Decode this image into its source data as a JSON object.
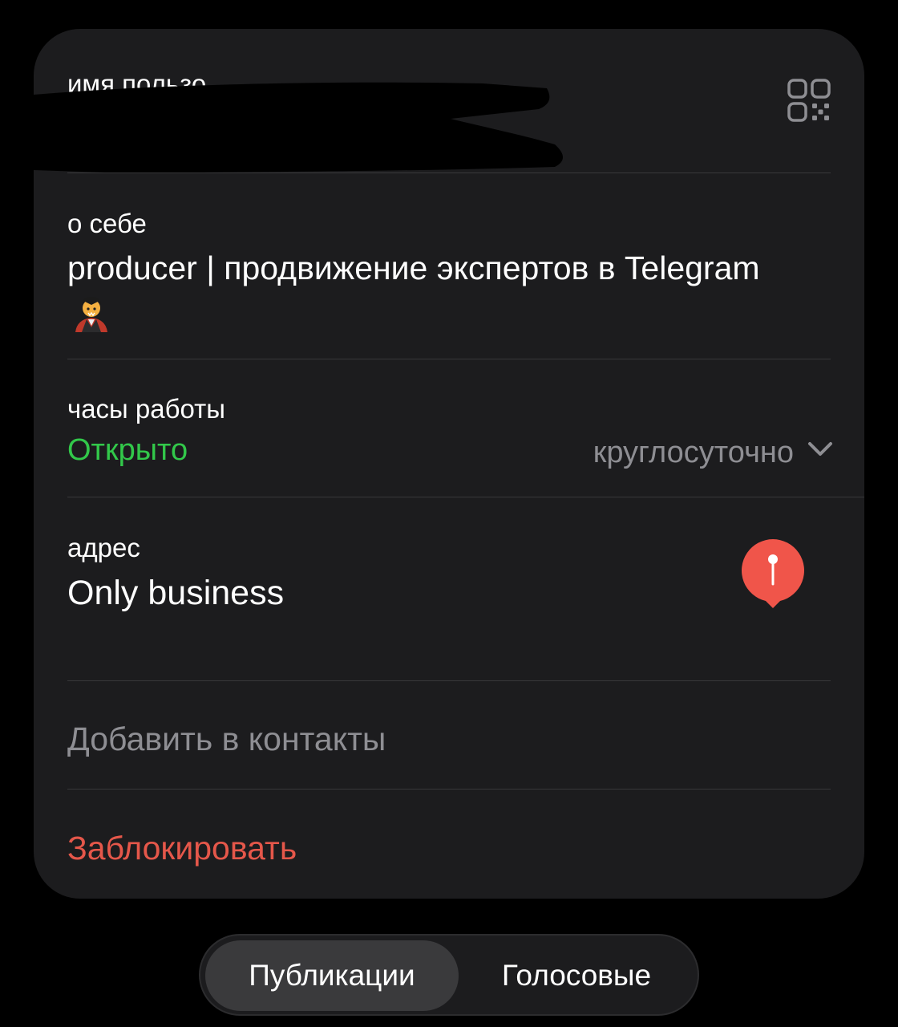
{
  "profile": {
    "username_label": "имя пользо",
    "about_label": "о себе",
    "about_value": "producer | продвижение экспертов в Telegram",
    "about_emoji": "vampire-emoji",
    "hours_label": "часы работы",
    "hours_status": "Открыто",
    "hours_value": "круглосуточно",
    "address_label": "адрес",
    "address_value": "Only business",
    "add_contact": "Добавить в контакты",
    "block": "Заблокировать"
  },
  "tabs": [
    {
      "label": "Публикации",
      "active": true
    },
    {
      "label": "Голосовые",
      "active": false
    }
  ],
  "colors": {
    "open_status": "#32c84a",
    "block_action": "#e5574a",
    "pin": "#f0554a",
    "secondary_text": "#8e8e93"
  },
  "icons": [
    "qr-code-icon",
    "chevron-down-icon",
    "map-pin-icon"
  ]
}
